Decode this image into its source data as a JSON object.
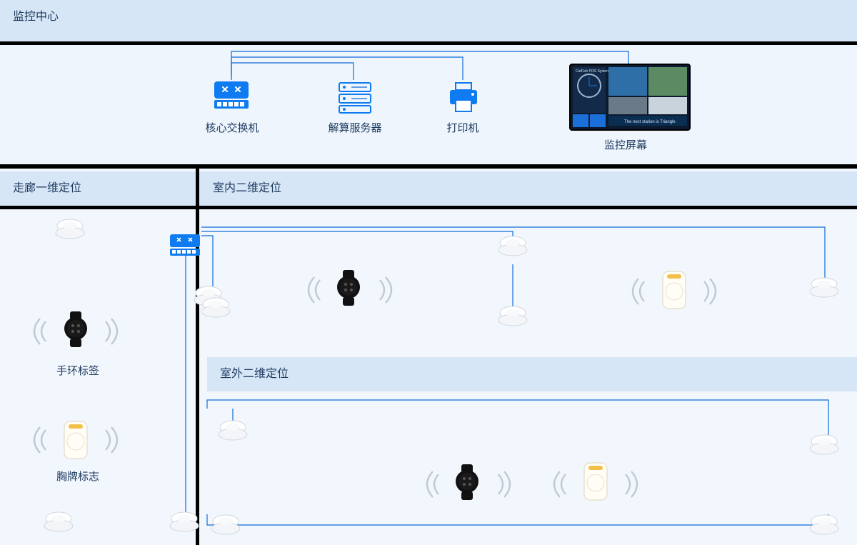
{
  "title_main": "监控中心",
  "title_corridor": "走廊一维定位",
  "title_indoor": "室内二维定位",
  "title_outdoor": "室外二维定位",
  "device_switch": "核心交换机",
  "device_server": "解算服务器",
  "device_printer": "打印机",
  "device_screen": "监控屏幕",
  "device_watch": "手环标签",
  "device_badge": "胸牌标志",
  "colors": {
    "accent": "#0f6bd8",
    "panel": "#d7e6f7",
    "bg": "#eef5fd"
  },
  "monitor_ui": {
    "top_left_label": "CatFish POS System",
    "bottom_banner": "The next station is Triangle"
  }
}
